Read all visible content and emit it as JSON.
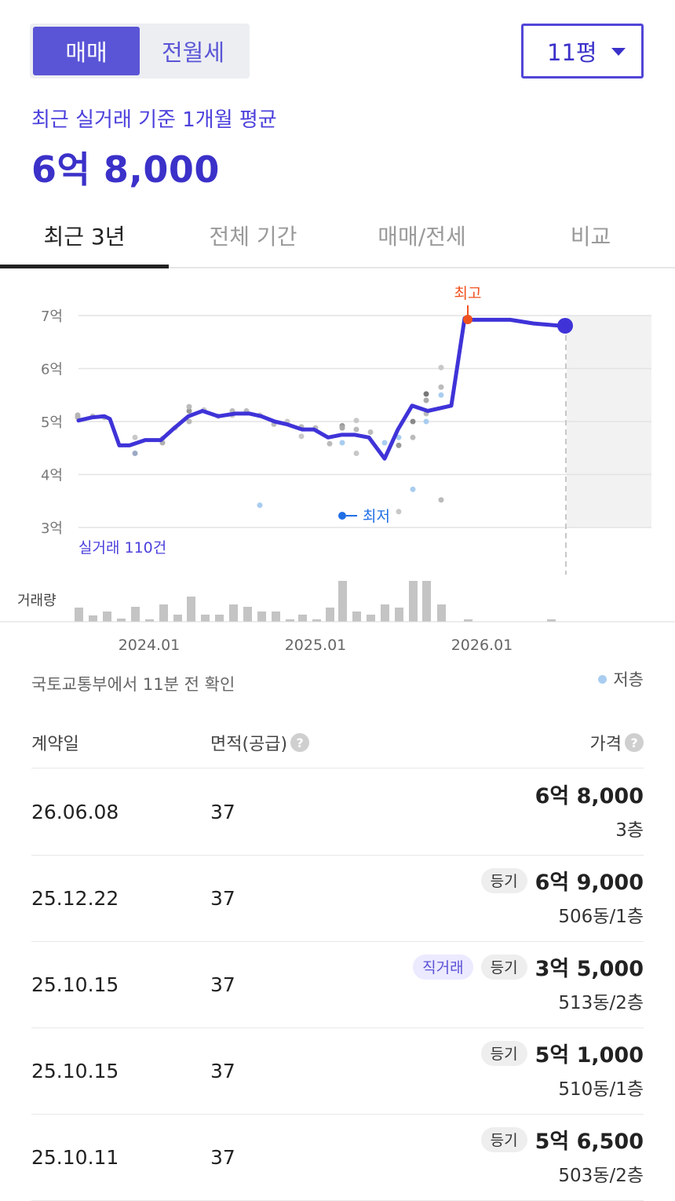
{
  "trade_type": {
    "sale": "매매",
    "rent": "전월세"
  },
  "area_select": {
    "value": "11평"
  },
  "summary": {
    "label": "최근 실거래 기준 1개월 평균",
    "price": "6억 8,000"
  },
  "tabs": [
    "최근 3년",
    "전체 기간",
    "매매/전세",
    "비교"
  ],
  "chart": {
    "high_label": "최고",
    "low_label": "최저",
    "count_label": "실거래 110건",
    "volume_label": "거래량"
  },
  "chart_data": {
    "type": "line",
    "y_ticks": [
      "7억",
      "6억",
      "5억",
      "4억",
      "3억"
    ],
    "ylim": [
      3,
      7
    ],
    "x_ticks": [
      "2024.01",
      "2025.01",
      "2026.01"
    ],
    "annotations": [
      "최고",
      "최저"
    ],
    "series": [
      {
        "values": [
          5.02,
          5.08,
          5.1,
          5.05,
          4.55,
          4.55,
          4.65,
          4.65,
          4.85,
          5.1,
          5.2,
          5.1,
          5.15,
          5.15,
          5.1,
          5.0,
          4.95,
          4.85,
          4.85,
          4.7,
          4.75,
          4.75,
          4.7,
          4.3,
          4.85,
          5.3,
          5.2,
          5.3,
          6.95,
          6.92,
          6.92,
          6.92,
          6.85,
          6.8
        ]
      }
    ]
  },
  "source_note": "국토교통부에서 11분 전 확인",
  "legend": {
    "low_floor": "저층"
  },
  "table": {
    "headers": {
      "date": "계약일",
      "area": "면적(공급)",
      "price": "가격"
    },
    "rows": [
      {
        "date": "26.06.08",
        "area": "37",
        "badges": [],
        "price": "6억 8,000",
        "floor": "3층"
      },
      {
        "date": "25.12.22",
        "area": "37",
        "badges": [
          "등기"
        ],
        "price": "6억 9,000",
        "floor": "506동/1층"
      },
      {
        "date": "25.10.15",
        "area": "37",
        "badges": [
          "직거래",
          "등기"
        ],
        "price": "3억 5,000",
        "floor": "513동/2층"
      },
      {
        "date": "25.10.15",
        "area": "37",
        "badges": [
          "등기"
        ],
        "price": "5억 1,000",
        "floor": "510동/1층"
      },
      {
        "date": "25.10.11",
        "area": "37",
        "badges": [
          "등기"
        ],
        "price": "5억 6,500",
        "floor": "503동/2층"
      }
    ]
  }
}
